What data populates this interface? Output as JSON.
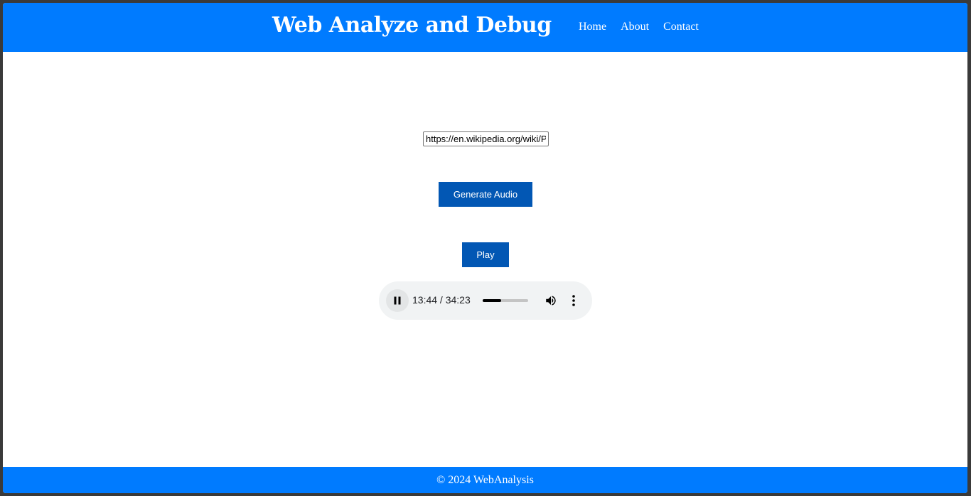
{
  "header": {
    "title": "Web Analyze and Debug",
    "nav": [
      "Home",
      "About",
      "Contact"
    ]
  },
  "main": {
    "url_input_value": "https://en.wikipedia.org/wiki/Python_(programming_language)",
    "generate_button_label": "Generate Audio",
    "play_button_label": "Play"
  },
  "audio_player": {
    "state": "playing",
    "current_time": "13:44",
    "duration": "34:23",
    "time_display": "13:44 / 34:23",
    "progress_fraction": 0.4,
    "icons": {
      "play_pause": "pause-icon",
      "volume": "volume-icon",
      "menu": "more-vert-icon"
    }
  },
  "footer": {
    "text": "© 2024 WebAnalysis"
  },
  "colors": {
    "header_bg": "#007bff",
    "button_bg": "#0257b4",
    "footer_bg": "#007bff",
    "player_bg": "#f1f3f4"
  }
}
